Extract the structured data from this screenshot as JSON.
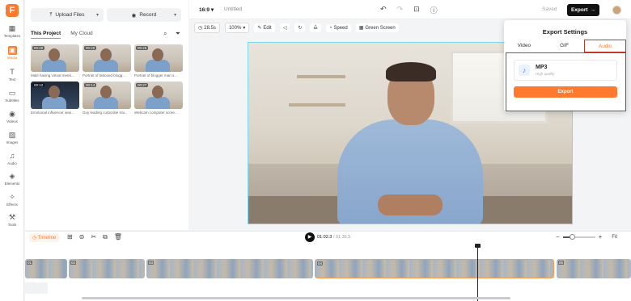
{
  "app": {
    "logo_letter": "F",
    "brand_color": "#ff7a2e"
  },
  "rail": {
    "items": [
      {
        "label": "Templates",
        "icon": "templates-icon",
        "glyph": "▦"
      },
      {
        "label": "Media",
        "icon": "media-icon",
        "glyph": "▣",
        "active": true
      },
      {
        "label": "Text",
        "icon": "text-icon",
        "glyph": "T"
      },
      {
        "label": "Subtitles",
        "icon": "subtitles-icon",
        "glyph": "▭"
      },
      {
        "label": "Videos",
        "icon": "videos-icon",
        "glyph": "◉"
      },
      {
        "label": "Images",
        "icon": "images-icon",
        "glyph": "▨"
      },
      {
        "label": "Audio",
        "icon": "audio-icon",
        "glyph": "♫"
      },
      {
        "label": "Elements",
        "icon": "elements-icon",
        "glyph": "◈"
      },
      {
        "label": "Effects",
        "icon": "effects-icon",
        "glyph": "✧"
      },
      {
        "label": "Tools",
        "icon": "tools-icon",
        "glyph": "⚒"
      }
    ]
  },
  "panel": {
    "upload_label": "Upload Files",
    "record_label": "Record",
    "tabs": [
      "This Project",
      "My Cloud"
    ],
    "thumbs": [
      {
        "duration": "00:20",
        "caption": "Male having virtual meeti..."
      },
      {
        "duration": "00:20",
        "caption": "Portrait of tattooed blogg..."
      },
      {
        "duration": "00:25",
        "caption": "Portrait of blogger man s..."
      },
      {
        "duration": "00:12",
        "caption": "Emotional influencer wan...",
        "dark": true
      },
      {
        "duration": "00:14",
        "caption": "Guy leading corporate trai..."
      },
      {
        "duration": "00:27",
        "caption": "Webcam computer scree..."
      }
    ]
  },
  "topbar": {
    "aspect": "16:9",
    "title": "Untitled",
    "saved": "Saved",
    "export": "Export"
  },
  "toolbar": {
    "duration": "28.5s",
    "zoom": "100%",
    "edit": "Edit",
    "speed": "Speed",
    "green_screen": "Green Screen"
  },
  "export_popover": {
    "title": "Export Settings",
    "tabs": [
      "Video",
      "GIF",
      "Audio"
    ],
    "active_tab": "Audio",
    "format_name": "MP3",
    "format_sub": "High quality",
    "export_button": "Export"
  },
  "timeline": {
    "label": "Timeline",
    "current_time": "01:02.3",
    "total_time": "/ 01:36.5",
    "fit": "Fit",
    "zoom_level": 0.3,
    "clips": [
      {
        "num": "01"
      },
      {
        "num": "02"
      },
      {
        "num": "03"
      },
      {
        "num": "04"
      },
      {
        "num": "05"
      }
    ]
  }
}
